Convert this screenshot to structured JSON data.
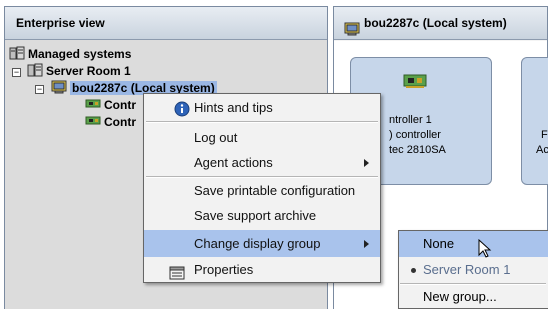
{
  "left_pane": {
    "title": "Enterprise view",
    "tree": [
      {
        "label": "Managed systems",
        "icon": "managed-systems-icon",
        "expander": ""
      },
      {
        "label": "Server Room 1",
        "icon": "server-room-icon",
        "expander": "−"
      },
      {
        "label": "bou2287c (Local system)",
        "icon": "computer-icon",
        "expander": "−"
      },
      {
        "label": "Contr",
        "icon": "controller-card-icon"
      },
      {
        "label": "Contr",
        "icon": "controller-card-icon"
      }
    ]
  },
  "right_pane": {
    "title": "bou2287c (Local system)",
    "cards": [
      {
        "lines": [
          "ntroller 1",
          ") controller",
          "tec 2810SA"
        ]
      },
      {
        "lines": [
          "F",
          "Ac"
        ]
      }
    ]
  },
  "context_menu": {
    "items": [
      {
        "label": "Hints and tips",
        "icon": "info-icon"
      },
      {
        "label": "Log out"
      },
      {
        "label": "Agent actions",
        "submenu": true
      },
      {
        "label": "Save printable configuration"
      },
      {
        "label": "Save support archive"
      },
      {
        "label": "Change display group",
        "submenu": true,
        "highlighted": true
      },
      {
        "label": "Properties",
        "icon": "properties-icon"
      }
    ]
  },
  "submenu": {
    "items": [
      {
        "label": "None",
        "highlighted": true
      },
      {
        "label": "Server Room 1",
        "current": true
      },
      {
        "label": "New group..."
      }
    ]
  },
  "colors": {
    "selection": "#9ab7e4",
    "menu_highlight": "#a9c3ec",
    "card_fill": "#c6d6ea",
    "header_gradient_top": "#e8edf3",
    "header_gradient_bottom": "#c9d3de"
  }
}
